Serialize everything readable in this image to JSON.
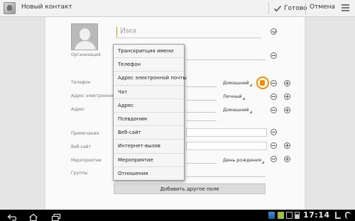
{
  "app": {
    "title": "Новый контакт",
    "done_label": "Готово",
    "cancel_label": "Отмена",
    "icons": [
      "contacts-app-icon",
      "check-icon",
      "overflow-menu-icon"
    ]
  },
  "form": {
    "name_placeholder": "Имя",
    "fields": {
      "organization": "Организация",
      "phone": "Телефон",
      "email": "Адрес электронной п...",
      "address": "Адрес",
      "notes": "Примечания",
      "website": "Веб-сайт",
      "event": "Мероприятие",
      "groups": "Группы"
    },
    "phone_type": "Домашний",
    "email_type": "Личный",
    "address_type": "Домашний",
    "event_type": "День рождения"
  },
  "popup": {
    "items": [
      "Транскрипция имени",
      "Телефон",
      "Адрес электронной почты",
      "Чат",
      "Адрес",
      "Псевдоним",
      "Веб-сайт",
      "Интернет-вызов",
      "Мероприятие",
      "Отношения"
    ]
  },
  "add_field_label": "Добавить другое поле",
  "status": {
    "clock": "17:14"
  },
  "colors": {
    "accent": "#ff8a00",
    "actionbar": "#f2f2f2",
    "systembar": "#000000"
  }
}
